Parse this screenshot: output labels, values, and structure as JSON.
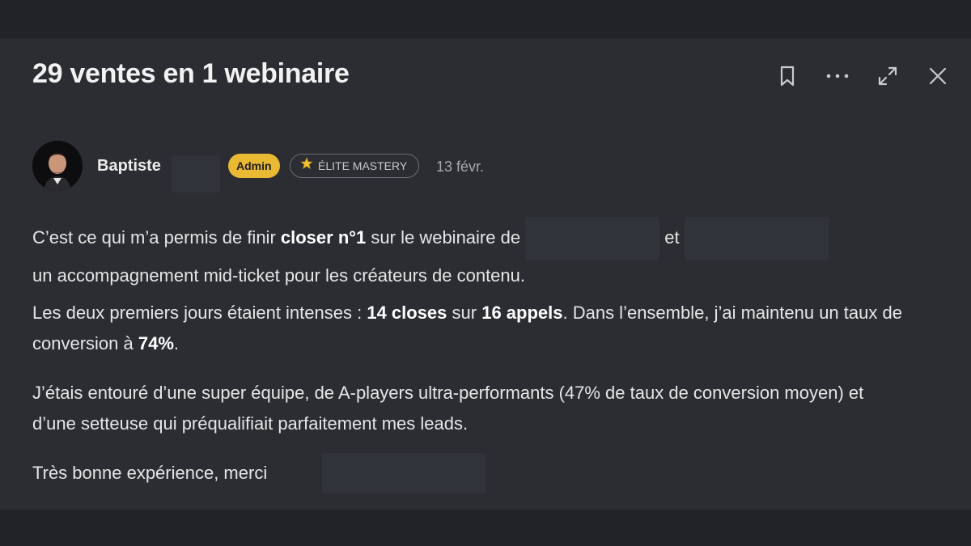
{
  "post": {
    "title": "29 ventes en 1 webinaire"
  },
  "header_actions": [
    {
      "name": "bookmark-icon"
    },
    {
      "name": "more-options-icon"
    },
    {
      "name": "expand-icon"
    },
    {
      "name": "close-icon"
    }
  ],
  "author": {
    "name": "Baptiste",
    "badge_admin": "Admin",
    "badge_elite": "ÉLITE MASTERY",
    "badge_elite_icon": "star-icon",
    "date": "13 févr."
  },
  "body": {
    "p1": {
      "a": "C’est ce qui m’a permis de finir ",
      "b_bold": "closer n°1",
      "c": " sur le webinaire de ",
      "d": " et ",
      "e": "un accompagnement mid-ticket pour les créateurs de contenu."
    },
    "p2": {
      "a": "Les deux premiers jours étaient intenses : ",
      "b_bold": "14 closes",
      "c": " sur ",
      "d_bold": "16 appels",
      "e": ". Dans l’ensemble, j’ai maintenu un taux de conversion à ",
      "f_bold": "74%",
      "g": "."
    },
    "p3": "J’étais entouré d’une super équipe, de A-players ultra-performants (47% de taux de conversion moyen) et d’une setteuse qui préqualifiait parfaitement mes leads.",
    "p4": "Très bonne expérience, merci"
  },
  "colors": {
    "background": "#212327",
    "panel": "#2b2d32",
    "admin_badge": "#e9b934",
    "text": "#e6e6e6"
  }
}
